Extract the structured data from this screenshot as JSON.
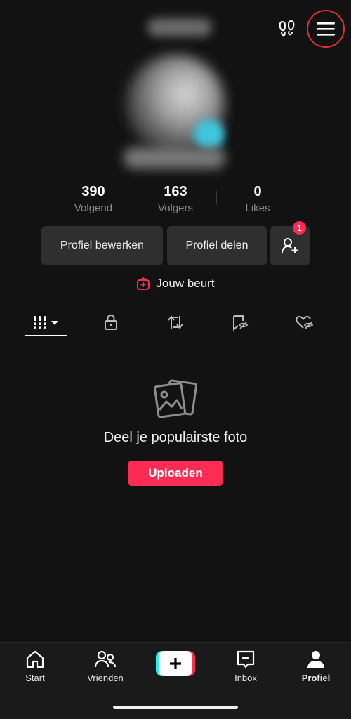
{
  "header": {
    "blurred_username": "",
    "footprints_icon": "footprints-icon",
    "menu_icon": "hamburger-menu-icon"
  },
  "profile": {
    "avatar_icon": "profile-avatar",
    "blurred_handle": ""
  },
  "stats": [
    {
      "value": "390",
      "label": "Volgend"
    },
    {
      "value": "163",
      "label": "Volgers"
    },
    {
      "value": "0",
      "label": "Likes"
    }
  ],
  "actions": {
    "edit_profile": "Profiel bewerken",
    "share_profile": "Profiel delen",
    "add_friend_badge": "1"
  },
  "turn": {
    "label": "Jouw beurt",
    "accent": "#fe2c55"
  },
  "tabs": [
    {
      "icon": "grid-icon",
      "selected": true
    },
    {
      "icon": "lock-icon"
    },
    {
      "icon": "repost-icon"
    },
    {
      "icon": "bookmark-hidden-icon"
    },
    {
      "icon": "heart-hidden-icon"
    }
  ],
  "empty": {
    "title": "Deel je populairste foto",
    "upload_label": "Uploaden"
  },
  "nav": {
    "start": "Start",
    "friends": "Vrienden",
    "inbox": "Inbox",
    "profile": "Profiel"
  },
  "colors": {
    "accent": "#fe2c55",
    "cyan": "#25f4ee",
    "background": "#121212"
  }
}
